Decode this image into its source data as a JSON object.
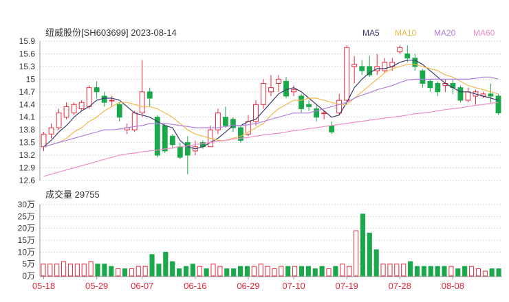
{
  "header": {
    "title": "纽威股份[SH603699] 2023-08-14"
  },
  "legend": [
    {
      "label": "MA5",
      "color": "#3a3a6a"
    },
    {
      "label": "MA10",
      "color": "#f2b84b"
    },
    {
      "label": "MA20",
      "color": "#b07ee0"
    },
    {
      "label": "MA60",
      "color": "#f08cc8"
    }
  ],
  "volume_header": {
    "label": "成交量 29755"
  },
  "colors": {
    "up": "#e8273a",
    "down": "#1aa84a",
    "grid": "#d9d9d9",
    "axis_text": "#333333",
    "date_text": "#e8273a"
  },
  "chart_data": [
    {
      "type": "candlestick",
      "title": "纽威股份[SH603699] 2023-08-14",
      "ylim": [
        12.6,
        15.9
      ],
      "yticks": [
        "15.9",
        "15.6",
        "15.3",
        "15",
        "14.7",
        "14.4",
        "14.1",
        "13.8",
        "13.5",
        "13.2",
        "12.9",
        "12.6"
      ],
      "x_tick_labels": [
        {
          "index": 0,
          "label": "05-18"
        },
        {
          "index": 7,
          "label": "05-29"
        },
        {
          "index": 13,
          "label": "06-07"
        },
        {
          "index": 20,
          "label": "06-16"
        },
        {
          "index": 27,
          "label": "06-29"
        },
        {
          "index": 33,
          "label": "07-10"
        },
        {
          "index": 40,
          "label": "07-19"
        },
        {
          "index": 47,
          "label": "07-28"
        },
        {
          "index": 54,
          "label": "08-08"
        }
      ],
      "ohlc": [
        [
          13.4,
          13.7,
          13.3,
          13.75
        ],
        [
          13.7,
          13.85,
          13.6,
          13.95
        ],
        [
          13.85,
          14.2,
          13.8,
          14.3
        ],
        [
          14.1,
          14.35,
          14.05,
          14.45
        ],
        [
          14.2,
          14.4,
          14.15,
          14.45
        ],
        [
          14.3,
          14.45,
          14.25,
          14.5
        ],
        [
          14.35,
          14.8,
          14.3,
          14.85
        ],
        [
          14.8,
          14.7,
          14.55,
          14.95
        ],
        [
          14.6,
          14.45,
          14.35,
          14.7
        ],
        [
          14.5,
          14.5,
          14.35,
          14.6
        ],
        [
          14.4,
          14.1,
          14.0,
          14.45
        ],
        [
          13.8,
          13.85,
          13.7,
          13.95
        ],
        [
          13.8,
          14.2,
          13.75,
          14.25
        ],
        [
          14.2,
          14.7,
          14.1,
          15.45
        ],
        [
          14.7,
          14.55,
          14.35,
          14.8
        ],
        [
          14.1,
          13.2,
          13.15,
          14.15
        ],
        [
          13.9,
          13.3,
          13.25,
          13.95
        ],
        [
          13.65,
          13.45,
          13.35,
          13.7
        ],
        [
          13.4,
          13.15,
          13.1,
          13.5
        ],
        [
          13.5,
          13.2,
          12.75,
          13.65
        ],
        [
          13.3,
          13.4,
          13.2,
          13.55
        ],
        [
          13.5,
          13.4,
          13.35,
          13.55
        ],
        [
          13.4,
          13.8,
          13.4,
          13.9
        ],
        [
          13.8,
          14.2,
          13.7,
          14.3
        ],
        [
          14.1,
          13.9,
          13.85,
          14.35
        ],
        [
          14.05,
          13.85,
          13.75,
          14.1
        ],
        [
          13.85,
          13.55,
          13.5,
          13.9
        ],
        [
          13.7,
          14.0,
          13.65,
          14.15
        ],
        [
          14.0,
          14.4,
          13.9,
          14.5
        ],
        [
          14.4,
          14.9,
          14.3,
          15.0
        ],
        [
          14.7,
          14.8,
          14.6,
          15.1
        ],
        [
          14.9,
          15.0,
          14.7,
          15.1
        ],
        [
          14.95,
          14.6,
          14.55,
          15.05
        ],
        [
          14.7,
          14.75,
          14.6,
          14.85
        ],
        [
          14.6,
          14.3,
          14.2,
          14.65
        ],
        [
          14.4,
          14.35,
          14.25,
          14.5
        ],
        [
          14.3,
          14.1,
          14.0,
          14.4
        ],
        [
          14.2,
          14.2,
          14.05,
          14.25
        ],
        [
          13.9,
          13.75,
          13.7,
          14.0
        ],
        [
          14.2,
          14.5,
          14.15,
          14.65
        ],
        [
          14.5,
          15.75,
          14.45,
          15.8
        ],
        [
          15.3,
          15.35,
          14.9,
          15.55
        ],
        [
          15.3,
          15.2,
          15.1,
          15.45
        ],
        [
          15.3,
          15.1,
          15.05,
          15.55
        ],
        [
          15.2,
          15.3,
          15.1,
          15.6
        ],
        [
          15.2,
          15.4,
          15.15,
          15.5
        ],
        [
          15.3,
          15.4,
          15.2,
          15.5
        ],
        [
          15.65,
          15.75,
          15.6,
          15.8
        ],
        [
          15.6,
          15.5,
          15.4,
          15.8
        ],
        [
          15.5,
          15.3,
          15.2,
          15.6
        ],
        [
          15.2,
          14.9,
          14.8,
          15.25
        ],
        [
          14.95,
          14.8,
          14.7,
          15.0
        ],
        [
          14.9,
          14.7,
          14.6,
          14.95
        ],
        [
          14.85,
          14.9,
          14.7,
          15.0
        ],
        [
          14.9,
          14.8,
          14.65,
          15.0
        ],
        [
          14.8,
          14.5,
          14.45,
          14.85
        ],
        [
          14.5,
          14.7,
          14.45,
          14.8
        ],
        [
          14.6,
          14.7,
          14.4,
          14.75
        ],
        [
          14.6,
          14.65,
          14.55,
          14.7
        ],
        [
          14.65,
          14.6,
          14.45,
          14.9
        ],
        [
          14.6,
          14.2,
          14.15,
          14.65
        ]
      ],
      "series": [
        {
          "name": "MA5",
          "values": [
            13.4,
            13.55,
            13.75,
            13.9,
            14.1,
            14.25,
            14.35,
            14.5,
            14.55,
            14.55,
            14.5,
            14.35,
            14.2,
            14.15,
            14.1,
            14.0,
            13.9,
            13.85,
            13.55,
            13.4,
            13.35,
            13.4,
            13.5,
            13.6,
            13.75,
            13.9,
            13.9,
            14.0,
            14.05,
            14.25,
            14.45,
            14.65,
            14.75,
            14.8,
            14.7,
            14.55,
            14.4,
            14.25,
            14.1,
            14.15,
            14.45,
            14.8,
            15.0,
            15.15,
            15.25,
            15.25,
            15.3,
            15.4,
            15.45,
            15.45,
            15.35,
            15.2,
            15.05,
            14.9,
            14.8,
            14.7,
            14.7,
            14.65,
            14.6,
            14.55,
            14.5
          ]
        },
        {
          "name": "MA10",
          "values": [
            13.4,
            13.45,
            13.5,
            13.6,
            13.75,
            13.85,
            14.0,
            14.1,
            14.25,
            14.35,
            14.45,
            14.45,
            14.4,
            14.35,
            14.35,
            14.3,
            14.2,
            14.1,
            13.95,
            13.8,
            13.7,
            13.65,
            13.6,
            13.55,
            13.55,
            13.6,
            13.65,
            13.75,
            13.85,
            13.95,
            14.15,
            14.3,
            14.4,
            14.5,
            14.5,
            14.55,
            14.55,
            14.5,
            14.45,
            14.4,
            14.4,
            14.55,
            14.7,
            14.85,
            15.0,
            15.15,
            15.25,
            15.3,
            15.35,
            15.35,
            15.3,
            15.25,
            15.2,
            15.1,
            15.05,
            14.95,
            14.85,
            14.8,
            14.75,
            14.7,
            14.65
          ]
        },
        {
          "name": "MA20",
          "values": [
            13.4,
            13.45,
            13.5,
            13.55,
            13.6,
            13.65,
            13.7,
            13.75,
            13.8,
            13.8,
            13.82,
            13.85,
            13.88,
            13.9,
            13.95,
            13.95,
            13.95,
            13.93,
            13.9,
            13.88,
            13.85,
            13.85,
            13.85,
            13.85,
            13.88,
            13.9,
            13.9,
            13.92,
            13.95,
            14.0,
            14.05,
            14.1,
            14.15,
            14.2,
            14.2,
            14.2,
            14.25,
            14.3,
            14.35,
            14.4,
            14.45,
            14.55,
            14.62,
            14.68,
            14.75,
            14.8,
            14.85,
            14.92,
            14.98,
            15.0,
            15.0,
            15.0,
            15.0,
            15.0,
            15.0,
            15.0,
            15.0,
            15.02,
            15.05,
            15.05,
            15.0
          ]
        },
        {
          "name": "MA60",
          "values": [
            12.7,
            12.75,
            12.8,
            12.85,
            12.9,
            12.95,
            13.0,
            13.05,
            13.1,
            13.15,
            13.2,
            13.23,
            13.25,
            13.28,
            13.3,
            13.32,
            13.35,
            13.37,
            13.4,
            13.42,
            13.45,
            13.48,
            13.5,
            13.53,
            13.55,
            13.58,
            13.6,
            13.62,
            13.65,
            13.68,
            13.7,
            13.72,
            13.75,
            13.78,
            13.8,
            13.83,
            13.85,
            13.88,
            13.9,
            13.93,
            13.95,
            13.98,
            14.0,
            14.03,
            14.05,
            14.08,
            14.1,
            14.12,
            14.15,
            14.18,
            14.2,
            14.22,
            14.25,
            14.28,
            14.3,
            14.32,
            14.35,
            14.38,
            14.4,
            14.43,
            14.45
          ]
        }
      ]
    },
    {
      "type": "bar",
      "title": "成交量 29755",
      "ylim": [
        0,
        30
      ],
      "unit": "万",
      "yticks": [
        "30万",
        "25万",
        "20万",
        "15万",
        "10万",
        "5万",
        "0万"
      ],
      "values": [
        5,
        5,
        5,
        6,
        5,
        5,
        5,
        6,
        5,
        5,
        4,
        3,
        3,
        3,
        4,
        4,
        9,
        5,
        10,
        6,
        3,
        4,
        5,
        4,
        3,
        5,
        4,
        3,
        3,
        4,
        4,
        4,
        5,
        4,
        3,
        4,
        4,
        4,
        4,
        4,
        3,
        4,
        3,
        4,
        5,
        4,
        19,
        26,
        18,
        11,
        5,
        5,
        5,
        5,
        6,
        4,
        4,
        4,
        4,
        4,
        4,
        3,
        4,
        4,
        3,
        2,
        3,
        3
      ]
    }
  ]
}
